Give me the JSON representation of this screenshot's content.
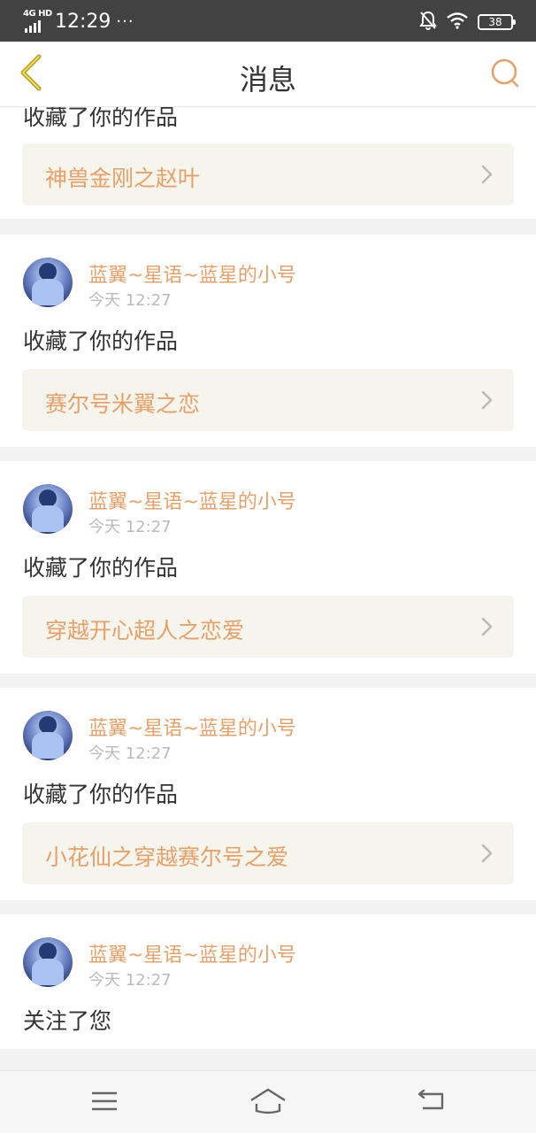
{
  "status_bar": {
    "network": "4G HD",
    "time": "12:29",
    "more": "···",
    "battery": "38"
  },
  "header": {
    "title": "消息"
  },
  "messages": [
    {
      "action": "收藏了你的作品",
      "work_title": "神兽金刚之赵叶"
    },
    {
      "username": "蓝翼~星语~蓝星的小号",
      "time": "今天 12:27",
      "action": "收藏了你的作品",
      "work_title": "赛尔号米翼之恋"
    },
    {
      "username": "蓝翼~星语~蓝星的小号",
      "time": "今天 12:27",
      "action": "收藏了你的作品",
      "work_title": "穿越开心超人之恋爱"
    },
    {
      "username": "蓝翼~星语~蓝星的小号",
      "time": "今天 12:27",
      "action": "收藏了你的作品",
      "work_title": "小花仙之穿越赛尔号之爱"
    },
    {
      "username": "蓝翼~星语~蓝星的小号",
      "time": "今天 12:27",
      "action": "关注了您"
    }
  ],
  "colors": {
    "accent": "#e9a068",
    "status_bar": "#424242",
    "back_icon": "#b7a224",
    "link_bg": "#f5f5ee"
  },
  "icons": {
    "back": "chevron-left-icon",
    "search": "search-icon",
    "link_arrow": "chevron-right-icon",
    "nav_menu": "menu-icon",
    "nav_home": "home-icon",
    "nav_back": "back-icon"
  }
}
